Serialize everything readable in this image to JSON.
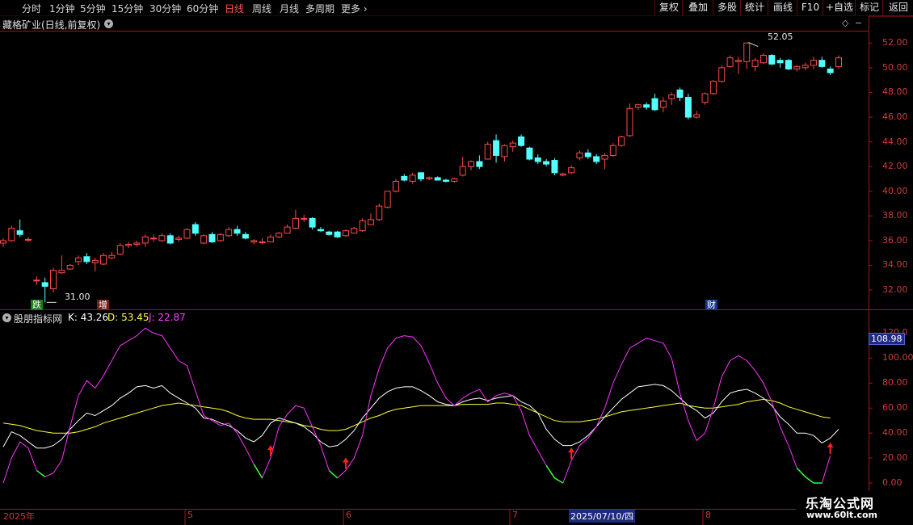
{
  "toolbar": {
    "periods": [
      "分时",
      "1分钟",
      "5分钟",
      "15分钟",
      "30分钟",
      "60分钟",
      "日线",
      "周线",
      "月线",
      "多周期",
      "更多"
    ],
    "active_period": "日线",
    "right_buttons": [
      "复权",
      "叠加",
      "多股",
      "统计",
      "画线",
      "F10",
      "+自选",
      "标记",
      "返回"
    ]
  },
  "stock_title": "藏格矿业(日线,前复权)",
  "indicator": {
    "name": "股朋指标网",
    "k_label": "K: 43.26",
    "d_label": "D: 53.45",
    "j_label": "J: 22.87",
    "current_value_box": "108.98"
  },
  "price_axis": [
    "52.00",
    "50.00",
    "48.00",
    "46.00",
    "44.00",
    "42.00",
    "40.00",
    "38.00",
    "36.00",
    "34.00",
    "32.00"
  ],
  "indicator_axis": [
    "120.0",
    "100.00",
    "80.00",
    "60.00",
    "40.00",
    "20.00",
    "0.00"
  ],
  "date_axis": [
    "2025年",
    "5",
    "6",
    "7",
    "8"
  ],
  "cursor_date": "2025/07/10/四",
  "annotations": {
    "high_label": "52.05",
    "low_label": "31.00",
    "marker_die": "跌",
    "marker_zeng": "增",
    "marker_cai": "财"
  },
  "watermark": {
    "line1": "乐淘公式网",
    "line2": "www.60lt.com"
  },
  "colors": {
    "up": "#ff4a4a",
    "down": "#54ffff",
    "k_line": "#ffffff",
    "d_line": "#ffff33",
    "j_line": "#ff33ff",
    "signal_arrow": "#ff2020",
    "frame": "#a01818"
  },
  "chart_data": {
    "type": "candlestick",
    "price_range": [
      30.5,
      53.0
    ],
    "candles": [
      {
        "o": 35.8,
        "h": 36.2,
        "l": 35.5,
        "c": 36.0
      },
      {
        "o": 36.0,
        "h": 37.2,
        "l": 35.9,
        "c": 37.0
      },
      {
        "o": 36.8,
        "h": 37.7,
        "l": 36.3,
        "c": 36.5
      },
      {
        "o": 36.1,
        "h": 36.3,
        "l": 35.9,
        "c": 36.1
      },
      {
        "o": 32.8,
        "h": 33.1,
        "l": 32.4,
        "c": 32.8
      },
      {
        "o": 32.6,
        "h": 33.0,
        "l": 31.0,
        "c": 32.3
      },
      {
        "o": 32.1,
        "h": 33.8,
        "l": 31.8,
        "c": 33.6
      },
      {
        "o": 33.4,
        "h": 34.8,
        "l": 33.3,
        "c": 33.6
      },
      {
        "o": 33.7,
        "h": 34.1,
        "l": 33.6,
        "c": 34.0
      },
      {
        "o": 34.3,
        "h": 34.8,
        "l": 34.0,
        "c": 34.6
      },
      {
        "o": 34.7,
        "h": 35.0,
        "l": 34.1,
        "c": 34.3
      },
      {
        "o": 34.2,
        "h": 34.6,
        "l": 33.5,
        "c": 34.4
      },
      {
        "o": 34.1,
        "h": 35.0,
        "l": 34.0,
        "c": 34.8
      },
      {
        "o": 34.6,
        "h": 35.1,
        "l": 34.5,
        "c": 34.8
      },
      {
        "o": 34.9,
        "h": 35.8,
        "l": 34.8,
        "c": 35.6
      },
      {
        "o": 35.6,
        "h": 35.9,
        "l": 35.4,
        "c": 35.7
      },
      {
        "o": 35.7,
        "h": 36.0,
        "l": 35.5,
        "c": 35.8
      },
      {
        "o": 35.8,
        "h": 36.5,
        "l": 35.5,
        "c": 36.3
      },
      {
        "o": 36.2,
        "h": 36.5,
        "l": 35.9,
        "c": 36.2
      },
      {
        "o": 36.0,
        "h": 36.6,
        "l": 35.9,
        "c": 36.4
      },
      {
        "o": 36.4,
        "h": 36.6,
        "l": 35.7,
        "c": 35.8
      },
      {
        "o": 36.1,
        "h": 36.4,
        "l": 35.9,
        "c": 36.2
      },
      {
        "o": 36.2,
        "h": 37.0,
        "l": 36.1,
        "c": 36.9
      },
      {
        "o": 37.3,
        "h": 37.5,
        "l": 36.4,
        "c": 36.6
      },
      {
        "o": 35.8,
        "h": 36.5,
        "l": 35.7,
        "c": 36.4
      },
      {
        "o": 36.5,
        "h": 36.7,
        "l": 35.8,
        "c": 35.9
      },
      {
        "o": 36.0,
        "h": 36.6,
        "l": 35.9,
        "c": 36.5
      },
      {
        "o": 36.4,
        "h": 37.1,
        "l": 36.3,
        "c": 36.9
      },
      {
        "o": 36.9,
        "h": 37.2,
        "l": 36.4,
        "c": 36.6
      },
      {
        "o": 36.5,
        "h": 36.7,
        "l": 36.1,
        "c": 36.2
      },
      {
        "o": 35.9,
        "h": 36.1,
        "l": 35.7,
        "c": 36.0
      },
      {
        "o": 35.9,
        "h": 36.2,
        "l": 35.7,
        "c": 35.9
      },
      {
        "o": 35.9,
        "h": 36.5,
        "l": 35.9,
        "c": 36.3
      },
      {
        "o": 36.3,
        "h": 36.7,
        "l": 36.2,
        "c": 36.6
      },
      {
        "o": 36.6,
        "h": 37.3,
        "l": 36.6,
        "c": 37.1
      },
      {
        "o": 37.0,
        "h": 38.5,
        "l": 36.9,
        "c": 37.8
      },
      {
        "o": 37.8,
        "h": 38.1,
        "l": 37.5,
        "c": 37.8
      },
      {
        "o": 37.8,
        "h": 37.9,
        "l": 36.9,
        "c": 37.1
      },
      {
        "o": 36.9,
        "h": 37.1,
        "l": 36.7,
        "c": 36.8
      },
      {
        "o": 36.7,
        "h": 36.8,
        "l": 36.4,
        "c": 36.5
      },
      {
        "o": 36.7,
        "h": 36.8,
        "l": 36.2,
        "c": 36.3
      },
      {
        "o": 36.4,
        "h": 36.9,
        "l": 36.3,
        "c": 36.8
      },
      {
        "o": 36.6,
        "h": 37.1,
        "l": 36.6,
        "c": 37.0
      },
      {
        "o": 36.8,
        "h": 37.8,
        "l": 36.7,
        "c": 37.6
      },
      {
        "o": 37.3,
        "h": 38.2,
        "l": 37.3,
        "c": 37.7
      },
      {
        "o": 37.7,
        "h": 39.0,
        "l": 37.6,
        "c": 38.8
      },
      {
        "o": 38.7,
        "h": 40.0,
        "l": 38.6,
        "c": 40.0
      },
      {
        "o": 40.0,
        "h": 41.0,
        "l": 39.9,
        "c": 40.8
      },
      {
        "o": 41.2,
        "h": 41.4,
        "l": 40.8,
        "c": 40.9
      },
      {
        "o": 40.8,
        "h": 41.5,
        "l": 40.6,
        "c": 41.3
      },
      {
        "o": 41.5,
        "h": 41.5,
        "l": 40.8,
        "c": 41.0
      },
      {
        "o": 41.0,
        "h": 41.2,
        "l": 40.9,
        "c": 41.1
      },
      {
        "o": 41.1,
        "h": 41.2,
        "l": 40.9,
        "c": 40.9
      },
      {
        "o": 40.9,
        "h": 41.0,
        "l": 40.7,
        "c": 40.8
      },
      {
        "o": 40.8,
        "h": 41.1,
        "l": 40.7,
        "c": 41.0
      },
      {
        "o": 41.3,
        "h": 42.8,
        "l": 41.2,
        "c": 42.0
      },
      {
        "o": 42.0,
        "h": 42.5,
        "l": 41.7,
        "c": 42.4
      },
      {
        "o": 42.4,
        "h": 42.9,
        "l": 41.8,
        "c": 42.0
      },
      {
        "o": 42.6,
        "h": 44.0,
        "l": 42.6,
        "c": 43.8
      },
      {
        "o": 44.1,
        "h": 44.6,
        "l": 42.3,
        "c": 42.9
      },
      {
        "o": 42.8,
        "h": 43.8,
        "l": 42.4,
        "c": 43.7
      },
      {
        "o": 43.6,
        "h": 44.1,
        "l": 43.2,
        "c": 43.9
      },
      {
        "o": 44.4,
        "h": 44.6,
        "l": 43.6,
        "c": 43.7
      },
      {
        "o": 43.5,
        "h": 43.6,
        "l": 42.5,
        "c": 42.6
      },
      {
        "o": 42.7,
        "h": 43.0,
        "l": 42.2,
        "c": 42.4
      },
      {
        "o": 42.4,
        "h": 42.6,
        "l": 42.0,
        "c": 42.2
      },
      {
        "o": 42.5,
        "h": 42.7,
        "l": 41.3,
        "c": 41.5
      },
      {
        "o": 41.3,
        "h": 41.5,
        "l": 41.2,
        "c": 41.4
      },
      {
        "o": 41.5,
        "h": 42.1,
        "l": 41.4,
        "c": 41.9
      },
      {
        "o": 42.7,
        "h": 43.3,
        "l": 42.5,
        "c": 43.1
      },
      {
        "o": 43.1,
        "h": 43.4,
        "l": 42.6,
        "c": 42.8
      },
      {
        "o": 42.8,
        "h": 43.0,
        "l": 42.2,
        "c": 42.4
      },
      {
        "o": 42.6,
        "h": 43.1,
        "l": 41.8,
        "c": 42.9
      },
      {
        "o": 42.9,
        "h": 43.9,
        "l": 42.8,
        "c": 43.7
      },
      {
        "o": 43.7,
        "h": 44.5,
        "l": 43.6,
        "c": 44.4
      },
      {
        "o": 44.5,
        "h": 47.1,
        "l": 44.4,
        "c": 46.7
      },
      {
        "o": 46.8,
        "h": 47.1,
        "l": 46.6,
        "c": 47.0
      },
      {
        "o": 47.0,
        "h": 47.2,
        "l": 46.6,
        "c": 46.8
      },
      {
        "o": 47.5,
        "h": 47.9,
        "l": 46.5,
        "c": 46.6
      },
      {
        "o": 46.8,
        "h": 47.6,
        "l": 46.4,
        "c": 47.3
      },
      {
        "o": 47.5,
        "h": 48.0,
        "l": 47.0,
        "c": 47.8
      },
      {
        "o": 48.2,
        "h": 48.4,
        "l": 47.3,
        "c": 47.6
      },
      {
        "o": 47.6,
        "h": 47.9,
        "l": 45.8,
        "c": 46.0
      },
      {
        "o": 46.0,
        "h": 46.5,
        "l": 45.9,
        "c": 46.2
      },
      {
        "o": 47.2,
        "h": 48.0,
        "l": 47.0,
        "c": 47.9
      },
      {
        "o": 47.9,
        "h": 49.0,
        "l": 47.8,
        "c": 48.9
      },
      {
        "o": 48.9,
        "h": 50.2,
        "l": 48.8,
        "c": 50.0
      },
      {
        "o": 50.1,
        "h": 51.0,
        "l": 50.0,
        "c": 50.8
      },
      {
        "o": 50.5,
        "h": 50.9,
        "l": 49.5,
        "c": 50.6
      },
      {
        "o": 50.5,
        "h": 52.05,
        "l": 49.9,
        "c": 52.0
      },
      {
        "o": 50.1,
        "h": 50.8,
        "l": 49.7,
        "c": 50.6
      },
      {
        "o": 50.4,
        "h": 51.2,
        "l": 50.3,
        "c": 51.0
      },
      {
        "o": 51.0,
        "h": 51.1,
        "l": 50.2,
        "c": 50.3
      },
      {
        "o": 50.6,
        "h": 50.8,
        "l": 50.0,
        "c": 50.4
      },
      {
        "o": 50.6,
        "h": 50.7,
        "l": 49.8,
        "c": 49.9
      },
      {
        "o": 49.9,
        "h": 50.2,
        "l": 49.7,
        "c": 50.1
      },
      {
        "o": 50.0,
        "h": 50.4,
        "l": 49.8,
        "c": 50.2
      },
      {
        "o": 50.2,
        "h": 50.9,
        "l": 49.9,
        "c": 50.6
      },
      {
        "o": 50.6,
        "h": 50.9,
        "l": 50.0,
        "c": 50.1
      },
      {
        "o": 49.9,
        "h": 50.1,
        "l": 49.4,
        "c": 49.6
      },
      {
        "o": 50.1,
        "h": 51.0,
        "l": 49.9,
        "c": 50.8
      }
    ],
    "indicator_range": [
      0,
      130
    ],
    "k": [
      29,
      41,
      38,
      33,
      28,
      28,
      30,
      35,
      43,
      50,
      56,
      54,
      58,
      62,
      68,
      72,
      77,
      78,
      76,
      78,
      72,
      68,
      64,
      60,
      52,
      51,
      48,
      46,
      42,
      36,
      33,
      38,
      48,
      52,
      50,
      48,
      45,
      40,
      33,
      29,
      30,
      35,
      42,
      52,
      60,
      68,
      73,
      76,
      77,
      77,
      74,
      70,
      65,
      63,
      62,
      65,
      67,
      68,
      66,
      68,
      69,
      70,
      65,
      62,
      56,
      43,
      35,
      30,
      30,
      33,
      38,
      45,
      53,
      60,
      67,
      72,
      77,
      78,
      79,
      78,
      74,
      68,
      62,
      58,
      52,
      56,
      65,
      72,
      74,
      75,
      72,
      68,
      62,
      53,
      47,
      40,
      40,
      38,
      32,
      36,
      43
    ],
    "d": [
      48,
      47,
      46,
      44,
      42,
      41,
      40,
      40,
      40,
      41,
      43,
      45,
      48,
      50,
      52,
      54,
      56,
      58,
      60,
      62,
      63,
      64,
      63,
      62,
      61,
      60,
      59,
      57,
      54,
      52,
      51,
      51,
      51,
      50,
      49,
      48,
      46,
      45,
      43,
      42,
      42,
      43,
      46,
      49,
      52,
      54,
      57,
      59,
      60,
      61,
      62,
      62,
      62,
      62,
      62,
      63,
      63,
      63,
      63,
      64,
      64,
      63,
      62,
      59,
      56,
      53,
      50,
      49,
      49,
      49,
      50,
      51,
      53,
      55,
      57,
      58,
      59,
      60,
      61,
      62,
      63,
      64,
      62,
      61,
      60,
      60,
      61,
      62,
      63,
      65,
      66,
      67,
      66,
      64,
      61,
      59,
      57,
      55,
      53,
      52
    ],
    "j": [
      0,
      20,
      33,
      28,
      10,
      5,
      8,
      18,
      45,
      70,
      82,
      76,
      86,
      98,
      110,
      114,
      118,
      124,
      120,
      118,
      108,
      98,
      94,
      74,
      54,
      50,
      46,
      48,
      40,
      28,
      15,
      4,
      20,
      45,
      55,
      62,
      60,
      45,
      30,
      10,
      4,
      10,
      20,
      38,
      70,
      92,
      108,
      116,
      118,
      117,
      110,
      96,
      80,
      68,
      62,
      68,
      72,
      75,
      65,
      70,
      72,
      70,
      58,
      38,
      26,
      14,
      4,
      0,
      18,
      30,
      36,
      45,
      60,
      80,
      95,
      108,
      112,
      116,
      114,
      112,
      100,
      72,
      50,
      34,
      40,
      60,
      85,
      98,
      102,
      98,
      90,
      80,
      65,
      45,
      30,
      12,
      5,
      0,
      0,
      22
    ]
  }
}
